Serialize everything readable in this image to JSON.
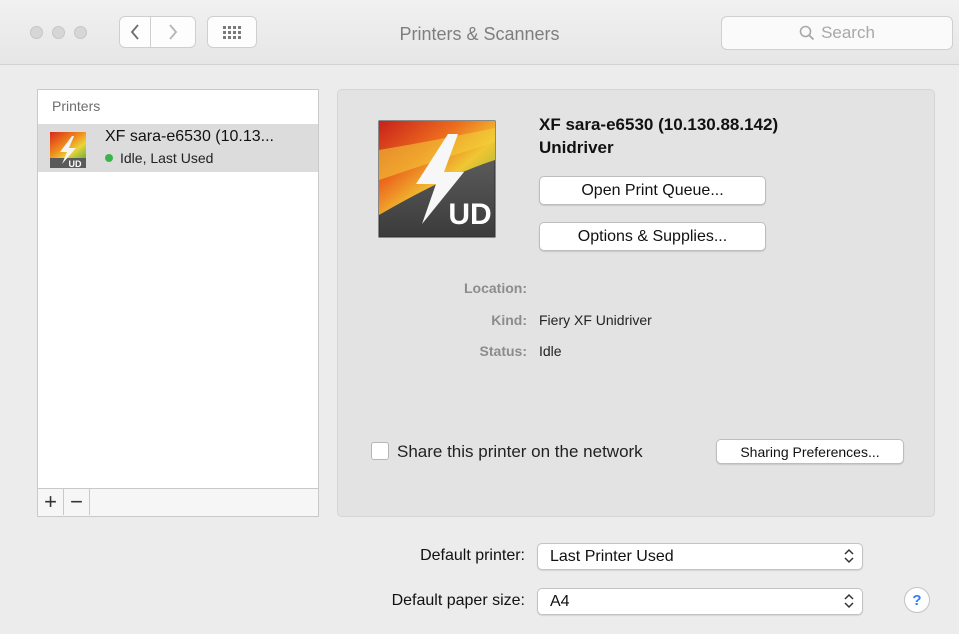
{
  "window": {
    "title": "Printers & Scanners",
    "search_placeholder": "Search",
    "back_glyph": "‹",
    "forward_glyph": "›"
  },
  "printers_list": {
    "header": "Printers",
    "items": [
      {
        "name": "XF sara-e6530 (10.13...",
        "status": "Idle, Last Used",
        "icon": "unidriver-icon",
        "status_color": "#3bb54a"
      }
    ],
    "add_glyph": "+",
    "remove_glyph": "−"
  },
  "details": {
    "name": "XF sara-e6530 (10.130.88.142)",
    "driver": "Unidriver",
    "open_queue_label": "Open Print Queue...",
    "options_label": "Options & Supplies...",
    "location_label": "Location:",
    "location_value": "",
    "kind_label": "Kind:",
    "kind_value": "Fiery XF Unidriver",
    "status_label": "Status:",
    "status_value": "Idle",
    "share_label": "Share this printer on the network",
    "share_checked": false,
    "sharing_prefs_label": "Sharing Preferences..."
  },
  "footer": {
    "default_printer_label": "Default printer:",
    "default_printer_value": "Last Printer Used",
    "default_paper_label": "Default paper size:",
    "default_paper_value": "A4",
    "help_glyph": "?"
  },
  "icon_badge": "UD"
}
